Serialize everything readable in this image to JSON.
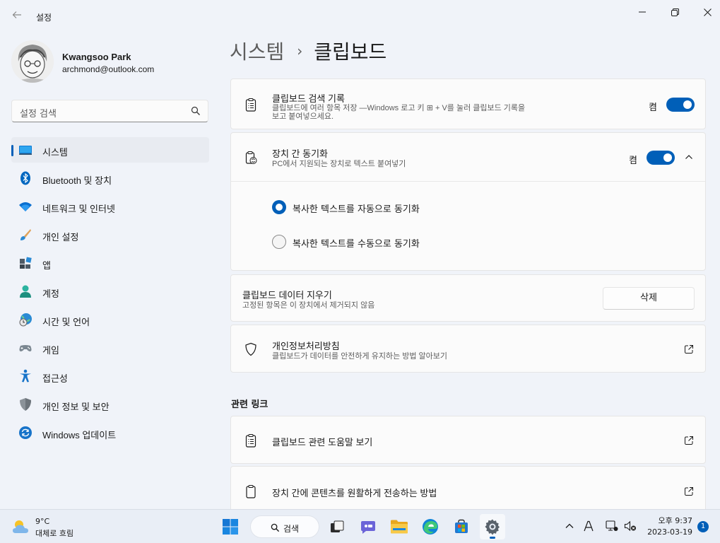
{
  "window": {
    "title": "설정"
  },
  "profile": {
    "name": "Kwangsoo Park",
    "email": "archmond@outlook.com"
  },
  "search": {
    "placeholder": "설정 검색"
  },
  "sidebar": {
    "items": [
      {
        "label": "시스템",
        "icon": "monitor-icon",
        "active": true
      },
      {
        "label": "Bluetooth 및 장치",
        "icon": "bluetooth-icon"
      },
      {
        "label": "네트워크 및 인터넷",
        "icon": "wifi-icon"
      },
      {
        "label": "개인 설정",
        "icon": "brush-icon"
      },
      {
        "label": "앱",
        "icon": "apps-icon"
      },
      {
        "label": "계정",
        "icon": "person-icon"
      },
      {
        "label": "시간 및 언어",
        "icon": "globe-clock-icon"
      },
      {
        "label": "게임",
        "icon": "gamepad-icon"
      },
      {
        "label": "접근성",
        "icon": "accessibility-icon"
      },
      {
        "label": "개인 정보 및 보안",
        "icon": "shield-icon"
      },
      {
        "label": "Windows 업데이트",
        "icon": "update-icon"
      }
    ]
  },
  "breadcrumb": {
    "parent": "시스템",
    "separator": "›",
    "current": "클립보드"
  },
  "clipboard_history": {
    "title": "클립보드 검색 기록",
    "desc_line1": "클립보드에 여러 항목 저장 —Windows 로고 키 ⊞ + V를 눌러 클립보드 기록을",
    "desc_line2": "보고 붙여넣으세요.",
    "state_label": "켬",
    "enabled": true
  },
  "sync": {
    "title": "장치 간 동기화",
    "desc": "PC에서 지원되는 장치로 텍스트 붙여넣기",
    "state_label": "켬",
    "enabled": true,
    "options": [
      {
        "label": "복사한 텍스트를 자동으로 동기화",
        "selected": true
      },
      {
        "label": "복사한 텍스트를 수동으로 동기화",
        "selected": false
      }
    ]
  },
  "clear": {
    "title": "클립보드 데이터 지우기",
    "desc": "고정된 항목은 이 장치에서 제거되지 않음",
    "button": "삭제"
  },
  "privacy": {
    "title": "개인정보처리방침",
    "desc": "클립보드가 데이터를 안전하게 유지하는 방법 알아보기"
  },
  "related": {
    "heading": "관련 링크",
    "links": [
      {
        "label": "클립보드 관련 도움말 보기"
      },
      {
        "label": "장치 간에 콘텐츠를 원활하게 전송하는 방법"
      }
    ]
  },
  "taskbar": {
    "weather_temp": "9°C",
    "weather_cond": "대체로 흐림",
    "search_label": "검색",
    "time": "오후 9:37",
    "date": "2023-03-19",
    "notification_count": "1"
  },
  "colors": {
    "accent": "#005fb8",
    "background": "#f0f3f9",
    "card": "#fbfbfb"
  }
}
